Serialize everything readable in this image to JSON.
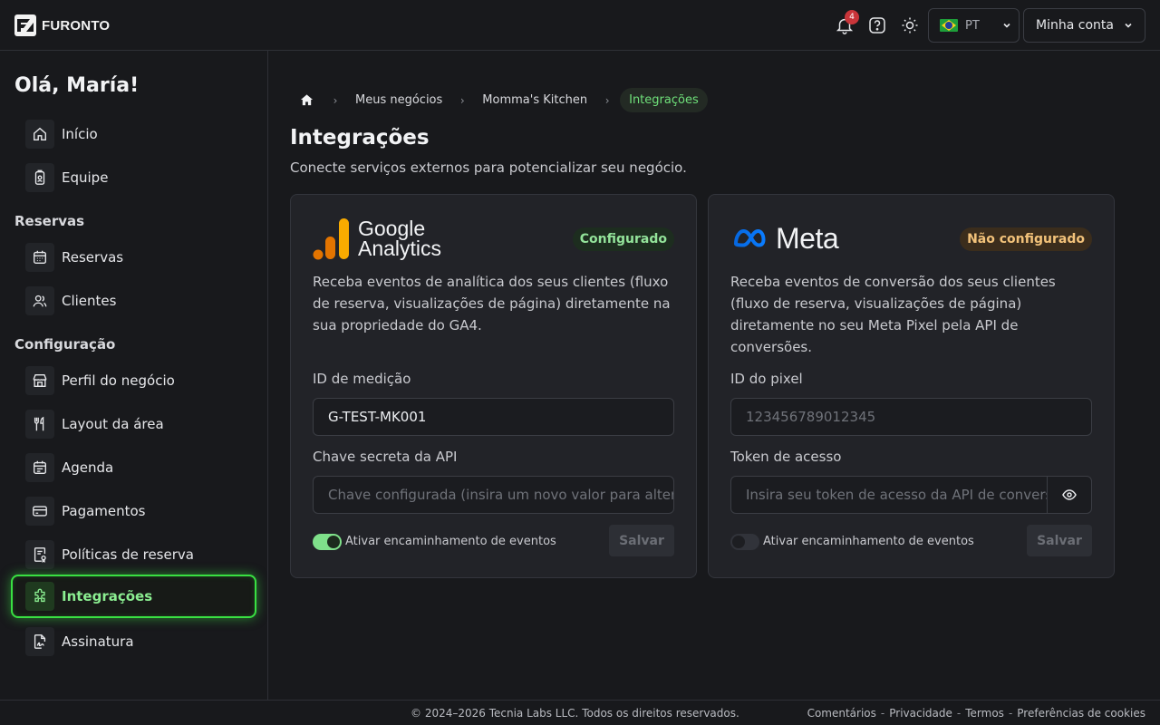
{
  "app": {
    "brand": "FURONTO"
  },
  "header": {
    "notifications_count": "4",
    "language": "PT",
    "account_label": "Minha conta"
  },
  "sidebar": {
    "greeting": "Olá, María!",
    "items_top": [
      {
        "label": "Início",
        "icon": "home-icon"
      },
      {
        "label": "Equipe",
        "icon": "badge-icon"
      }
    ],
    "section_reservas": "Reservas",
    "items_reservas": [
      {
        "label": "Reservas",
        "icon": "calendar-icon"
      },
      {
        "label": "Clientes",
        "icon": "users-icon"
      }
    ],
    "section_config": "Configuração",
    "items_config": [
      {
        "label": "Perfil do negócio",
        "icon": "store-icon"
      },
      {
        "label": "Layout da área",
        "icon": "utensils-icon"
      },
      {
        "label": "Agenda",
        "icon": "schedule-icon"
      },
      {
        "label": "Pagamentos",
        "icon": "card-icon"
      },
      {
        "label": "Políticas de reserva",
        "icon": "policy-icon"
      },
      {
        "label": "Integrações",
        "icon": "puzzle-icon",
        "active": true
      },
      {
        "label": "Assinatura",
        "icon": "signature-icon"
      }
    ]
  },
  "breadcrumb": {
    "items": [
      "Meus negócios",
      "Momma's Kitchen"
    ],
    "current": "Integrações"
  },
  "page": {
    "title": "Integrações",
    "subtitle": "Conecte serviços externos para potencializar seu negócio."
  },
  "cards": {
    "ga": {
      "logo_line1": "Google",
      "logo_line2": "Analytics",
      "status": "Configurado",
      "description": "Receba eventos de analítica dos seus clientes (fluxo de reserva, visualizações de página) diretamente na sua propriedade do GA4.",
      "field1_label": "ID de medição",
      "field1_value": "G-TEST-MK001",
      "field2_label": "Chave secreta da API",
      "field2_placeholder": "Chave configurada (insira um novo valor para alterar)",
      "toggle_label": "Ativar encaminhamento de eventos",
      "toggle_on": true,
      "save_label": "Salvar"
    },
    "meta": {
      "logo_text": "Meta",
      "status": "Não configurado",
      "description": "Receba eventos de conversão dos seus clientes (fluxo de reserva, visualizações de página) diretamente no seu Meta Pixel pela API de conversões.",
      "field1_label": "ID do pixel",
      "field1_placeholder": "123456789012345",
      "field2_label": "Token de acesso",
      "field2_placeholder": "Insira seu token de acesso da API de conversões",
      "toggle_label": "Ativar encaminhamento de eventos",
      "toggle_on": false,
      "save_label": "Salvar"
    }
  },
  "footer": {
    "copyright": "© 2024–2026 Tecnia Labs LLC. Todos os direitos reservados.",
    "links": [
      "Comentários",
      "Privacidade",
      "Termos",
      "Preferências de cookies"
    ],
    "separator": "-"
  },
  "colors": {
    "accent": "#39e042",
    "background": "#18191c",
    "card": "#222328"
  }
}
